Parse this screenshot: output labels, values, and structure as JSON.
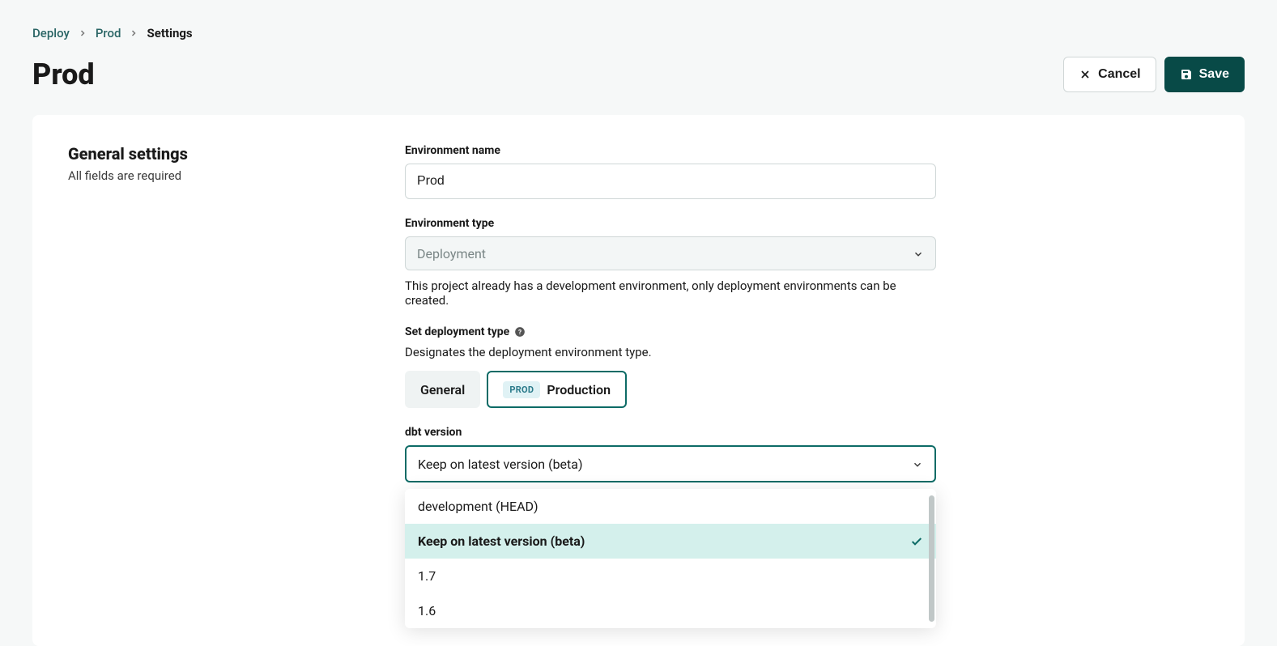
{
  "breadcrumb": {
    "items": [
      "Deploy",
      "Prod",
      "Settings"
    ]
  },
  "header": {
    "title": "Prod",
    "cancel_label": "Cancel",
    "save_label": "Save"
  },
  "section": {
    "heading": "General settings",
    "subheading": "All fields are required"
  },
  "form": {
    "env_name": {
      "label": "Environment name",
      "value": "Prod"
    },
    "env_type": {
      "label": "Environment type",
      "value": "Deployment",
      "helper": "This project already has a development environment, only deployment environments can be created."
    },
    "deploy_type": {
      "label": "Set deployment type",
      "desc": "Designates the deployment environment type.",
      "option_general": "General",
      "option_production_badge": "PROD",
      "option_production_label": "Production"
    },
    "dbt_version": {
      "label": "dbt version",
      "selected": "Keep on latest version (beta)",
      "options": [
        "development (HEAD)",
        "Keep on latest version (beta)",
        "1.7",
        "1.6"
      ]
    }
  }
}
